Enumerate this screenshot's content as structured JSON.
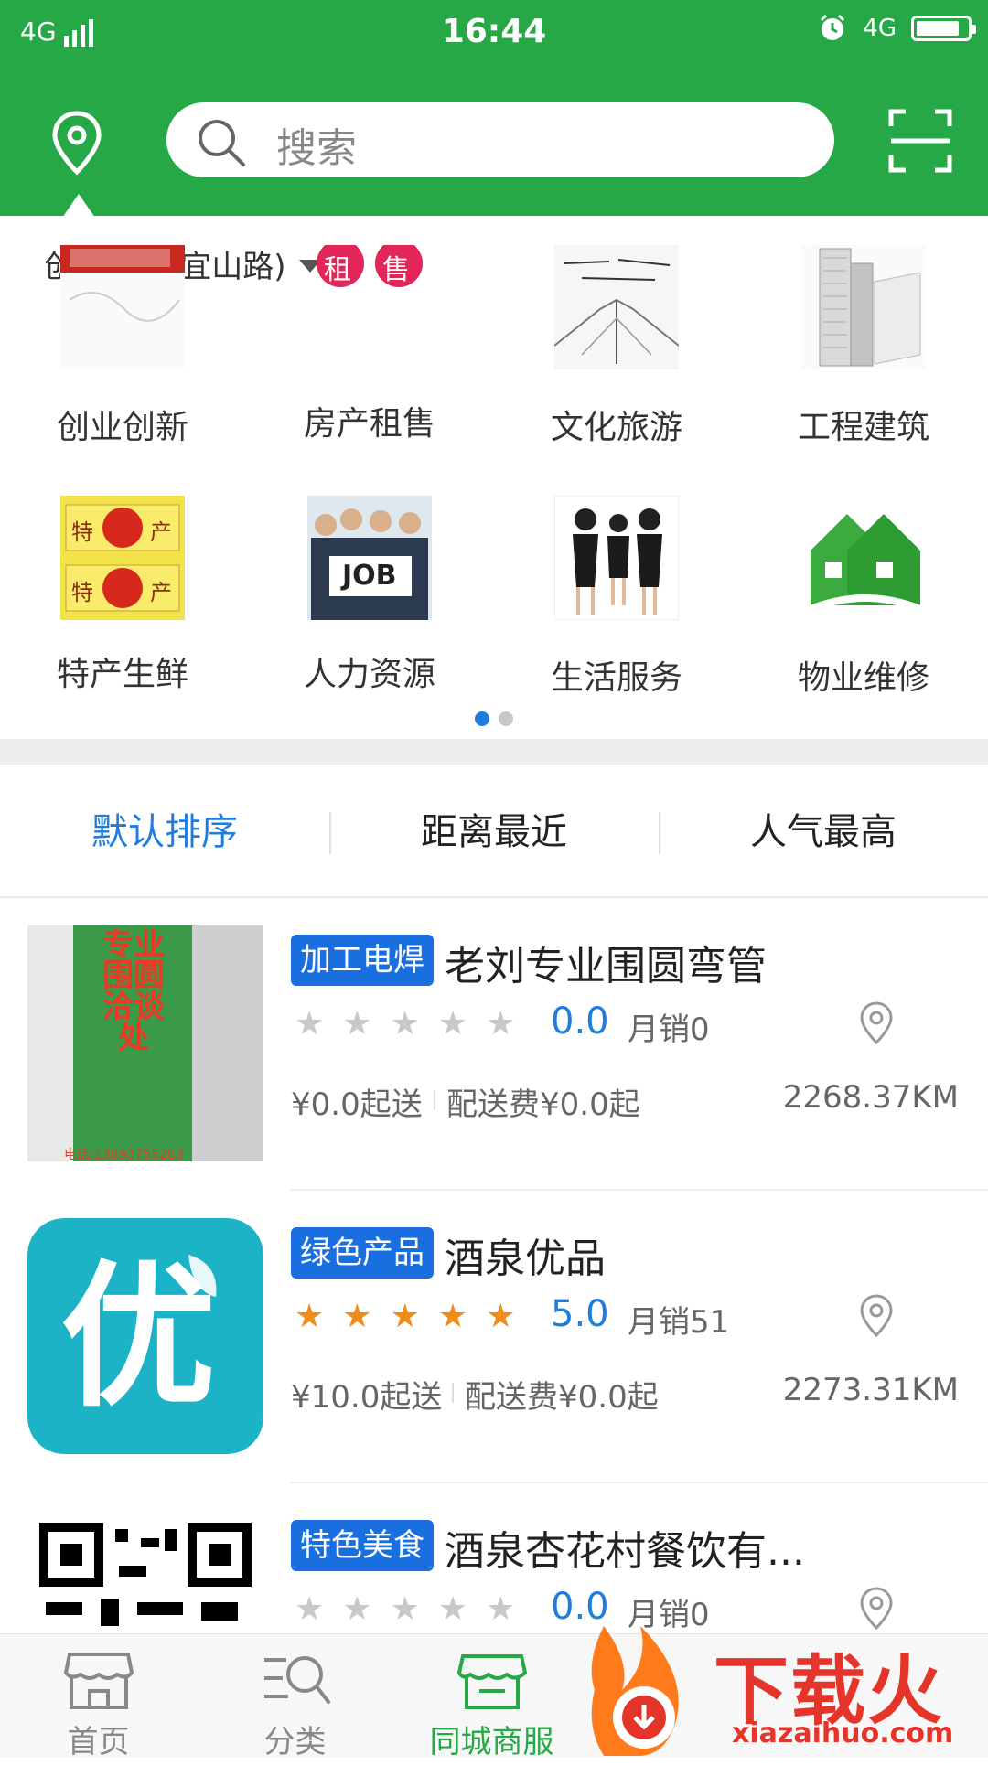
{
  "status_bar": {
    "network_left": "4G",
    "time": "16:44",
    "network_right": "4G"
  },
  "header": {
    "search_placeholder": "搜索"
  },
  "location": {
    "label": "创新大楼(宜山路)"
  },
  "categories": [
    {
      "label": "创业创新",
      "icon": "startup-banner-image"
    },
    {
      "label": "房产租售",
      "icon": "rent-sale-badges",
      "badges": [
        "租",
        "售"
      ]
    },
    {
      "label": "文化旅游",
      "icon": "culture-sketch-image"
    },
    {
      "label": "工程建筑",
      "icon": "building-image"
    },
    {
      "label": "特产生鲜",
      "icon": "specialty-sign-image",
      "sign_chars": [
        "特",
        "产"
      ]
    },
    {
      "label": "人力资源",
      "icon": "job-people-image",
      "sign_text": "JOB"
    },
    {
      "label": "生活服务",
      "icon": "service-staff-image"
    },
    {
      "label": "物业维修",
      "icon": "green-house-image"
    }
  ],
  "pagination": {
    "total": 2,
    "active": 1
  },
  "sort_tabs": [
    {
      "label": "默认排序",
      "active": true
    },
    {
      "label": "距离最近",
      "active": false
    },
    {
      "label": "人气最高",
      "active": false
    }
  ],
  "shops": [
    {
      "tag": "加工电焊",
      "name": "老刘专业围圆弯管",
      "stars": 0,
      "rating": "0.0",
      "sales": "月销0",
      "min_order": "¥0.0起送",
      "delivery_fee": "配送费¥0.0起",
      "distance": "2268.37KM",
      "image": "welding-sign-photo",
      "sign_text": "专业围圆洽谈处",
      "sign_phone": "电话:13893755283"
    },
    {
      "tag": "绿色产品",
      "name": "酒泉优品",
      "stars": 5,
      "rating": "5.0",
      "sales": "月销51",
      "min_order": "¥10.0起送",
      "delivery_fee": "配送费¥0.0起",
      "distance": "2273.31KM",
      "image": "you-logo",
      "logo_char": "优"
    },
    {
      "tag": "特色美食",
      "name": "酒泉杏花村餐饮有...",
      "stars": 0,
      "rating": "0.0",
      "sales": "月销0",
      "min_order": "",
      "delivery_fee": "",
      "distance": "",
      "image": "qr-code-image"
    }
  ],
  "tab_bar": [
    {
      "label": "首页",
      "icon": "store-icon",
      "active": false
    },
    {
      "label": "分类",
      "icon": "category-search-icon",
      "active": false
    },
    {
      "label": "同城商服",
      "icon": "city-shop-icon",
      "active": true
    }
  ],
  "watermark": {
    "text": "下载火",
    "url": "xiazaihuo.com"
  },
  "colors": {
    "primary_green": "#25a845",
    "accent_blue": "#1f7de0",
    "tag_blue": "#1a6fe0",
    "star_orange": "#f08c1a"
  }
}
